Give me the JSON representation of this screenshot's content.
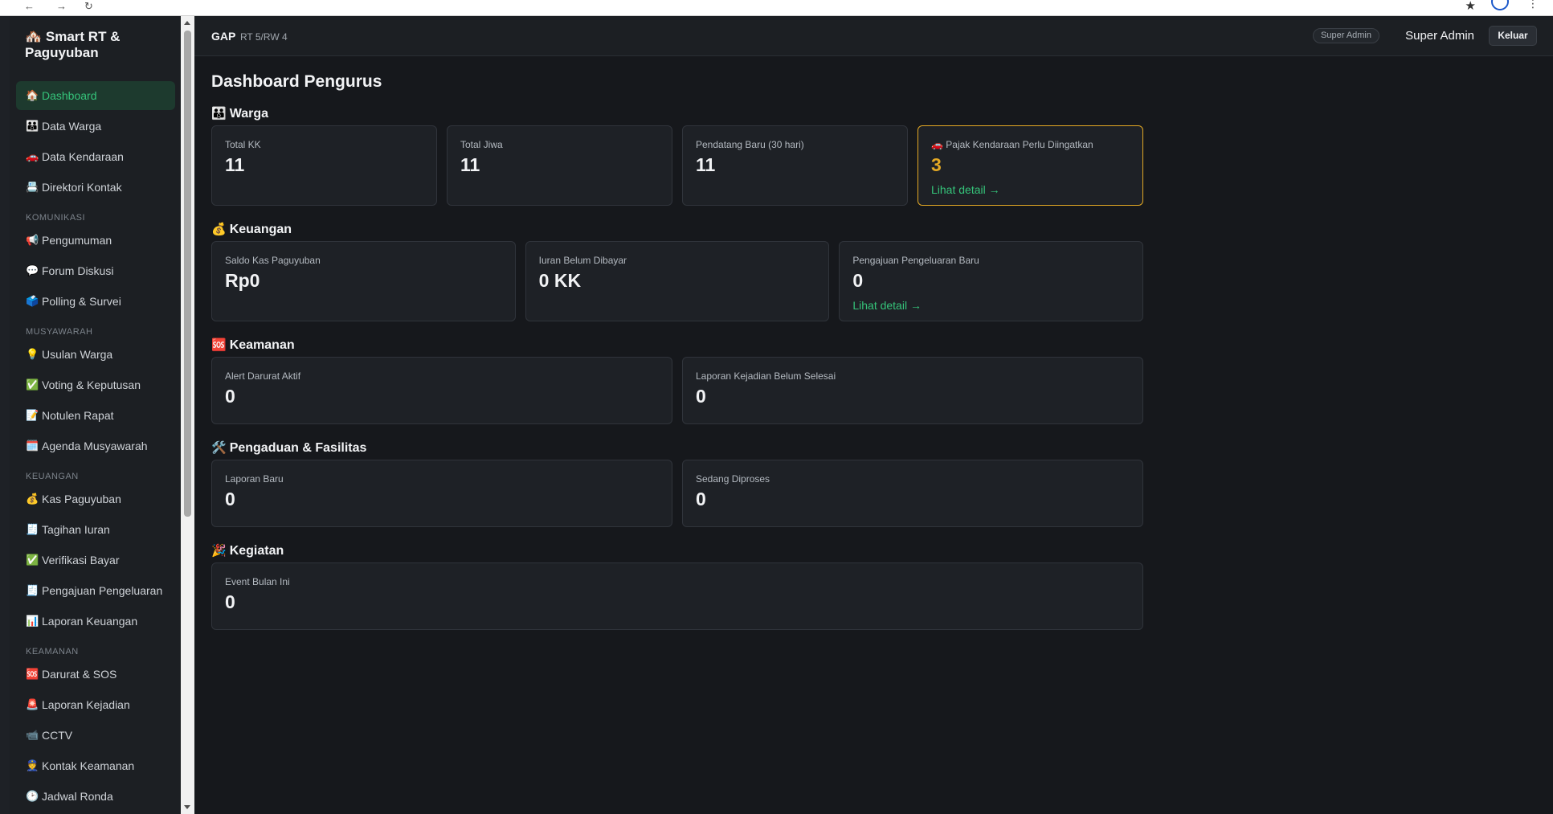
{
  "sidebar": {
    "brand": "🏘️ Smart RT & Paguyuban",
    "items": [
      {
        "icon": "🏠",
        "label": "Dashboard",
        "active": true
      },
      {
        "icon": "👪",
        "label": "Data Warga"
      },
      {
        "icon": "🚗",
        "label": "Data Kendaraan"
      },
      {
        "icon": "📇",
        "label": "Direktori Kontak"
      }
    ],
    "sections": [
      {
        "title": "KOMUNIKASI",
        "items": [
          {
            "icon": "📢",
            "label": "Pengumuman"
          },
          {
            "icon": "💬",
            "label": "Forum Diskusi"
          },
          {
            "icon": "🗳️",
            "label": "Polling & Survei"
          }
        ]
      },
      {
        "title": "MUSYAWARAH",
        "items": [
          {
            "icon": "💡",
            "label": "Usulan Warga"
          },
          {
            "icon": "✅",
            "label": "Voting & Keputusan"
          },
          {
            "icon": "📝",
            "label": "Notulen Rapat"
          },
          {
            "icon": "🗓️",
            "label": "Agenda Musyawarah"
          }
        ]
      },
      {
        "title": "KEUANGAN",
        "items": [
          {
            "icon": "💰",
            "label": "Kas Paguyuban"
          },
          {
            "icon": "🧾",
            "label": "Tagihan Iuran"
          },
          {
            "icon": "✅",
            "label": "Verifikasi Bayar"
          },
          {
            "icon": "🧾",
            "label": "Pengajuan Pengeluaran"
          },
          {
            "icon": "📊",
            "label": "Laporan Keuangan"
          }
        ]
      },
      {
        "title": "KEAMANAN",
        "items": [
          {
            "icon": "🆘",
            "label": "Darurat & SOS"
          },
          {
            "icon": "🚨",
            "label": "Laporan Kejadian"
          },
          {
            "icon": "📹",
            "label": "CCTV"
          },
          {
            "icon": "👮",
            "label": "Kontak Keamanan"
          },
          {
            "icon": "🕑",
            "label": "Jadwal Ronda"
          }
        ]
      }
    ]
  },
  "topbar": {
    "org": "GAP",
    "org_sub": "RT 5/RW 4",
    "role_badge": "Super Admin",
    "user": "Super Admin",
    "logout": "Keluar"
  },
  "page_title": "Dashboard Pengurus",
  "warga": {
    "title": "Warga",
    "icon": "👪",
    "total_kk": {
      "label": "Total KK",
      "value": "11"
    },
    "total_jiwa": {
      "label": "Total Jiwa",
      "value": "11"
    },
    "pendatang": {
      "label": "Pendatang Baru (30 hari)",
      "value": "11"
    },
    "pajak": {
      "label": "🚗 Pajak Kendaraan Perlu Diingatkan",
      "value": "3",
      "link": "Lihat detail →"
    }
  },
  "keuangan": {
    "title": "Keuangan",
    "icon": "💰",
    "saldo": {
      "label": "Saldo Kas Paguyuban",
      "value": "Rp0"
    },
    "iuran": {
      "label": "Iuran Belum Dibayar",
      "value": "0 KK"
    },
    "pengajuan": {
      "label": "Pengajuan Pengeluaran Baru",
      "value": "0",
      "link": "Lihat detail →"
    }
  },
  "keamanan": {
    "title": "Keamanan",
    "icon": "🆘",
    "alert": {
      "label": "Alert Darurat Aktif",
      "value": "0"
    },
    "laporan": {
      "label": "Laporan Kejadian Belum Selesai",
      "value": "0"
    }
  },
  "pengaduan": {
    "title": "Pengaduan & Fasilitas",
    "icon": "🛠️",
    "baru": {
      "label": "Laporan Baru",
      "value": "0"
    },
    "diproses": {
      "label": "Sedang Diproses",
      "value": "0"
    }
  },
  "kegiatan": {
    "title": "Kegiatan",
    "icon": "🎉",
    "event": {
      "label": "Event Bulan Ini",
      "value": "0"
    }
  },
  "colors": {
    "accent": "#35c47a",
    "warning": "#e3a824",
    "background": "#16181c",
    "card": "#1e2126"
  }
}
